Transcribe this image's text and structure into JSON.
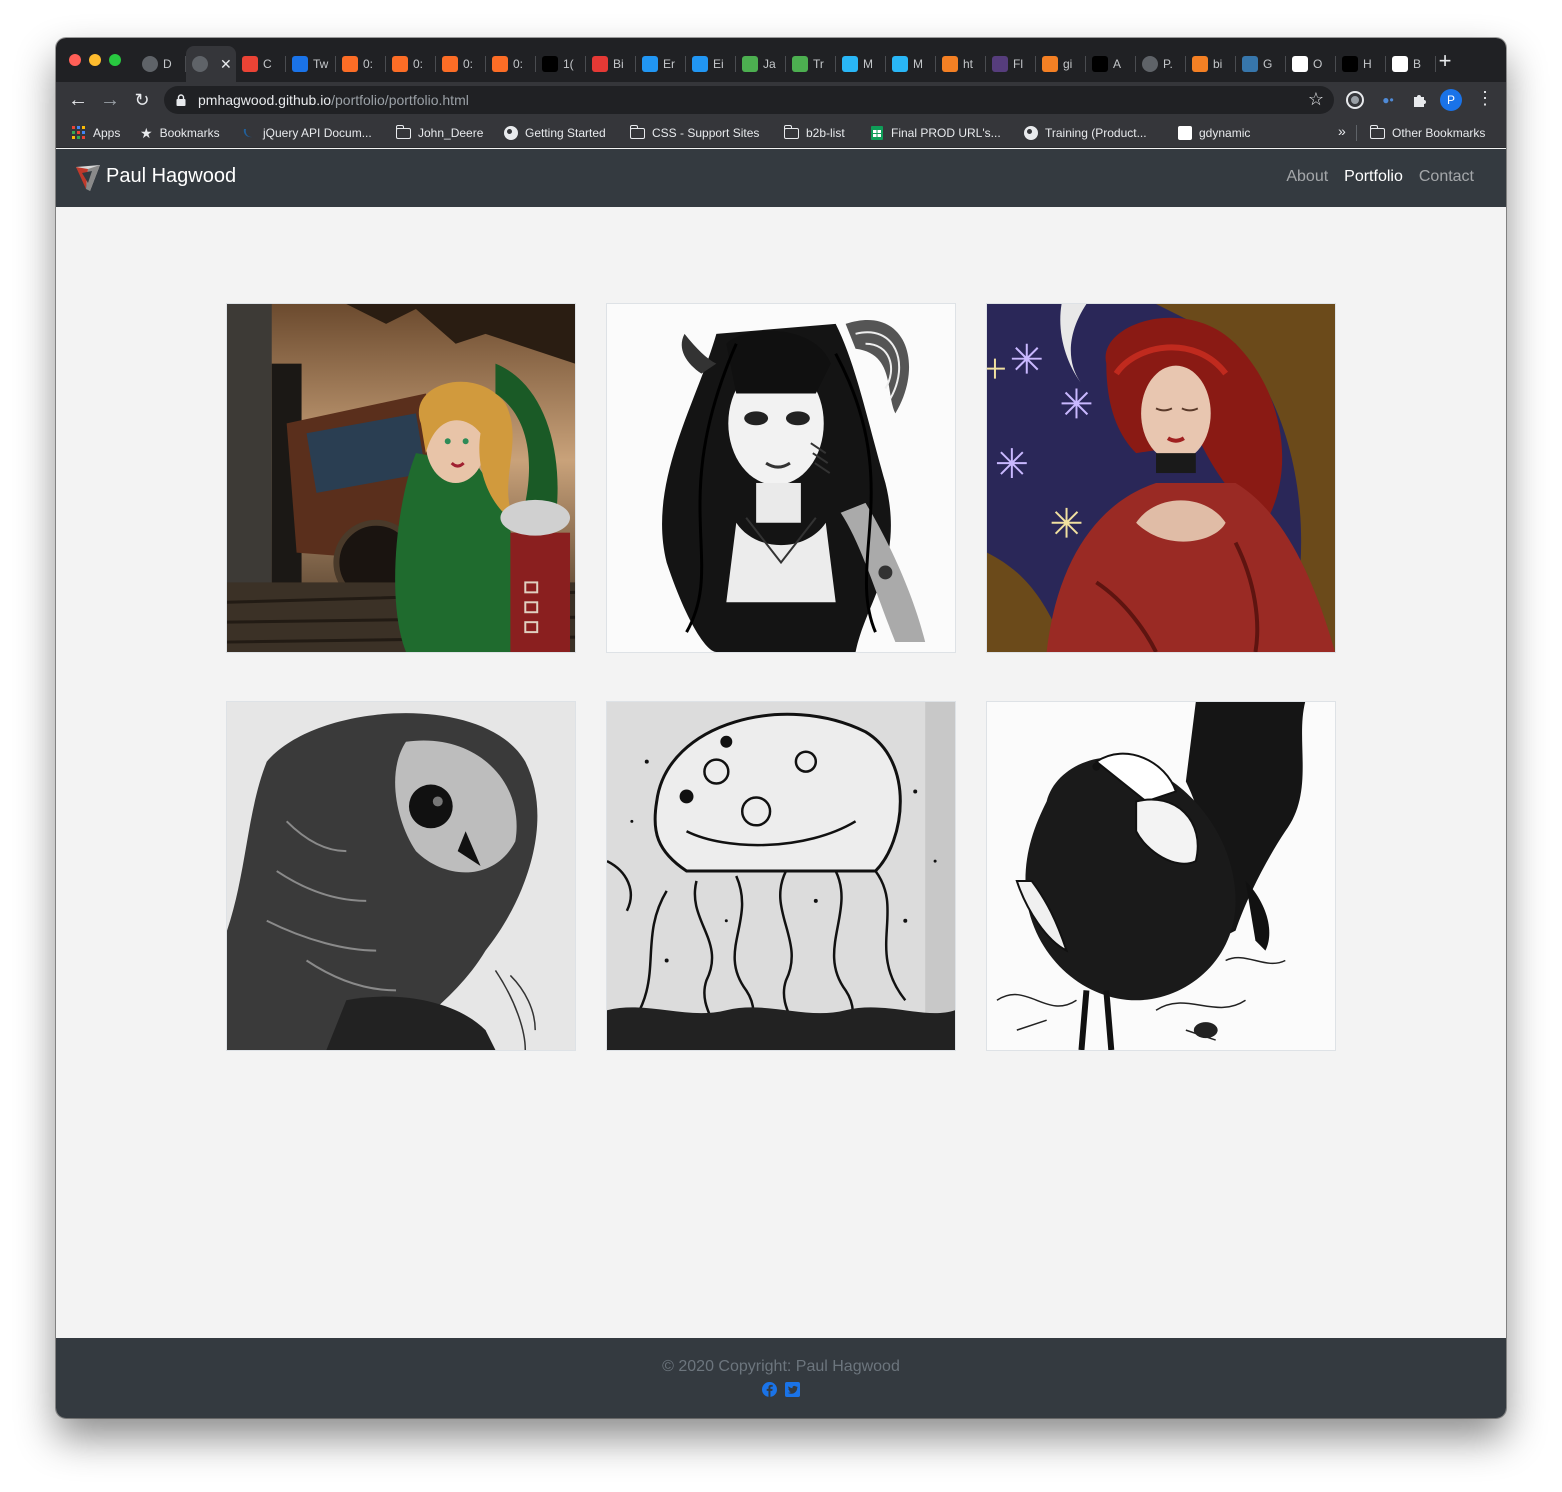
{
  "browser": {
    "tabs": [
      {
        "label": "D",
        "icon": "globe-icon",
        "color": "#5f6368"
      },
      {
        "label": "",
        "icon": "globe-icon",
        "color": "#5f6368",
        "active": true
      },
      {
        "label": "C",
        "icon": "gmail-icon",
        "color": "#ea4335"
      },
      {
        "label": "Tw",
        "icon": "flag-icon",
        "color": "#1a73e8"
      },
      {
        "label": "0:",
        "icon": "gitlab-icon",
        "color": "#fc6d26"
      },
      {
        "label": "0:",
        "icon": "gitlab-icon",
        "color": "#fc6d26"
      },
      {
        "label": "0:",
        "icon": "gitlab-icon",
        "color": "#fc6d26"
      },
      {
        "label": "0:",
        "icon": "gitlab-icon",
        "color": "#fc6d26"
      },
      {
        "label": "1(",
        "icon": "medium-icon",
        "color": "#000000"
      },
      {
        "label": "Bi",
        "icon": "red-circle-icon",
        "color": "#e53935"
      },
      {
        "label": "Er",
        "icon": "square-icon",
        "color": "#2196f3"
      },
      {
        "label": "Ei",
        "icon": "square-icon",
        "color": "#2196f3"
      },
      {
        "label": "Ja",
        "icon": "w3-icon",
        "color": "#4caf50"
      },
      {
        "label": "Tr",
        "icon": "w3-icon",
        "color": "#4caf50"
      },
      {
        "label": "M",
        "icon": "arrow-icon",
        "color": "#29b6f6"
      },
      {
        "label": "M",
        "icon": "arrow-icon",
        "color": "#29b6f6"
      },
      {
        "label": "ht",
        "icon": "stack-icon",
        "color": "#f48024"
      },
      {
        "label": "Fl",
        "icon": "bootstrap-icon",
        "color": "#563d7c"
      },
      {
        "label": "gi",
        "icon": "stack-icon",
        "color": "#f48024"
      },
      {
        "label": "A",
        "icon": "b-icon",
        "color": "#000000"
      },
      {
        "label": "P.",
        "icon": "globe-icon",
        "color": "#5f6368"
      },
      {
        "label": "bi",
        "icon": "stack-icon",
        "color": "#f48024"
      },
      {
        "label": "G",
        "icon": "python-icon",
        "color": "#3776ab"
      },
      {
        "label": "O",
        "icon": "question-icon",
        "color": "#ffffff"
      },
      {
        "label": "H",
        "icon": "medium-icon",
        "color": "#000000"
      },
      {
        "label": "B",
        "icon": "github-icon",
        "color": "#ffffff"
      }
    ],
    "new_tab": "+",
    "url_host": "pmhagwood.github.io",
    "url_path": "/portfolio/portfolio.html",
    "profile_initial": "P",
    "bookmarks": [
      {
        "label": "Apps",
        "icon": "apps-grid-icon"
      },
      {
        "label": "Bookmarks",
        "icon": "star-icon"
      },
      {
        "label": "jQuery API Docum...",
        "icon": "jquery-icon"
      },
      {
        "label": "John_Deere",
        "icon": "folder-icon"
      },
      {
        "label": "Getting Started",
        "icon": "globe-icon"
      },
      {
        "label": "CSS - Support Sites",
        "icon": "folder-icon"
      },
      {
        "label": "b2b-list",
        "icon": "folder-icon"
      },
      {
        "label": "Final PROD URL's...",
        "icon": "sheets-icon"
      },
      {
        "label": "Training (Product...",
        "icon": "globe-icon"
      },
      {
        "label": "gdynamic",
        "icon": "page-icon"
      }
    ],
    "overflow": "»",
    "other_bookmarks": "Other Bookmarks"
  },
  "site": {
    "brand": "Paul Hagwood",
    "nav": [
      {
        "label": "About",
        "active": false
      },
      {
        "label": "Portfolio",
        "active": true
      },
      {
        "label": "Contact",
        "active": false
      }
    ],
    "gallery": [
      {
        "subject": "steampunk girl with green cloak"
      },
      {
        "subject": "horned girl ink drawing"
      },
      {
        "subject": "red-haired woman in red dress"
      },
      {
        "subject": "owl pencil drawing"
      },
      {
        "subject": "jellyfish ink drawing"
      },
      {
        "subject": "crow ink drawing"
      }
    ],
    "footer": {
      "copyright": "© 2020 Copyright: Paul Hagwood",
      "social": [
        "facebook-icon",
        "twitter-icon"
      ]
    }
  },
  "colors": {
    "navbar": "#343a40",
    "page_bg": "#f3f3f3",
    "link_accent": "#1a73e8"
  }
}
